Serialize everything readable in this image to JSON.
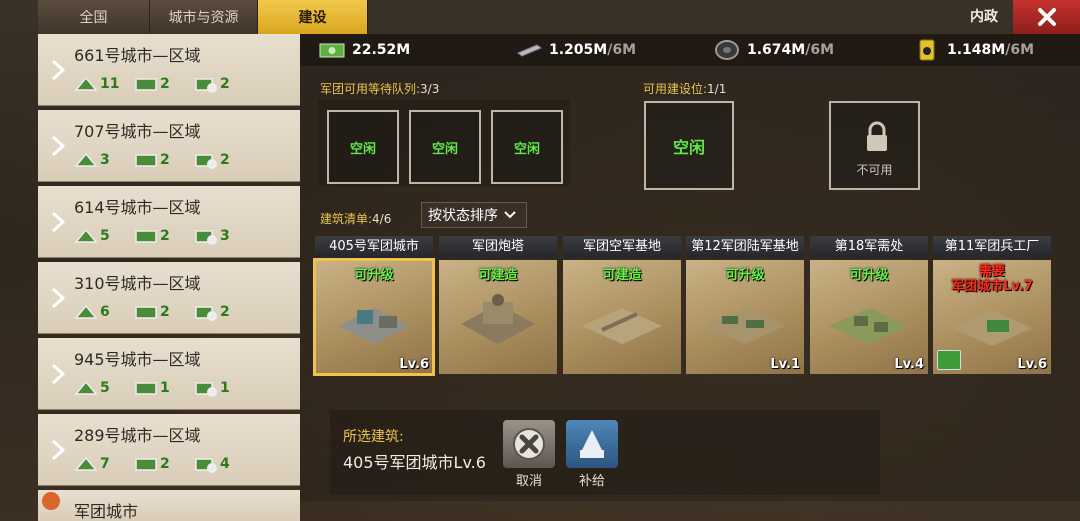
{
  "tabs": [
    {
      "label": "全国"
    },
    {
      "label": "城市与资源"
    },
    {
      "label": "建设",
      "active": true
    }
  ],
  "header": {
    "title": "内政",
    "close_icon": "close-icon"
  },
  "cities": [
    {
      "name": "661号城市—区域",
      "stat1": "11",
      "stat2": "2",
      "stat3": "2"
    },
    {
      "name": "707号城市—区域",
      "stat1": "3",
      "stat2": "2",
      "stat3": "2"
    },
    {
      "name": "614号城市—区域",
      "stat1": "5",
      "stat2": "2",
      "stat3": "3"
    },
    {
      "name": "310号城市—区域",
      "stat1": "6",
      "stat2": "2",
      "stat3": "2"
    },
    {
      "name": "945号城市—区域",
      "stat1": "5",
      "stat2": "1",
      "stat3": "1"
    },
    {
      "name": "289号城市—区域",
      "stat1": "7",
      "stat2": "2",
      "stat3": "4"
    }
  ],
  "legion_city": {
    "label": "军团城市"
  },
  "resources": [
    {
      "icon": "cash-icon",
      "value": "22.52M",
      "cap": ""
    },
    {
      "icon": "steel-icon",
      "value": "1.205M",
      "cap": "/6M"
    },
    {
      "icon": "rubber-icon",
      "value": "1.674M",
      "cap": "/6M"
    },
    {
      "icon": "oil-icon",
      "value": "1.148M",
      "cap": "/6M"
    }
  ],
  "queue": {
    "label": "军团可用等待队列:",
    "count": "3/3",
    "slots": [
      "空闲",
      "空闲",
      "空闲"
    ]
  },
  "build_slots": {
    "label": "可用建设位:",
    "count": "1/1",
    "slot": "空闲",
    "locked_label": "不可用"
  },
  "build_list": {
    "label": "建筑清单:",
    "count": "4/6",
    "sort_label": "按状态排序"
  },
  "buildings": [
    {
      "name": "405号军团城市",
      "status": "可升级",
      "level": "Lv.6"
    },
    {
      "name": "军团炮塔",
      "status": "可建造",
      "level": ""
    },
    {
      "name": "军团空军基地",
      "status": "可建造",
      "level": ""
    },
    {
      "name": "第12军团陆军基地",
      "status": "可升级",
      "level": "Lv.1"
    },
    {
      "name": "第18军需处",
      "status": "可升级",
      "level": "Lv.4"
    },
    {
      "name": "第11军团兵工厂",
      "status": "需要",
      "status2": "军团城市Lv.7",
      "level": "Lv.6"
    }
  ],
  "selected": {
    "label": "所选建筑:",
    "name": "405号军团城市Lv.6"
  },
  "actions": {
    "cancel": "取消",
    "supply": "补给"
  }
}
